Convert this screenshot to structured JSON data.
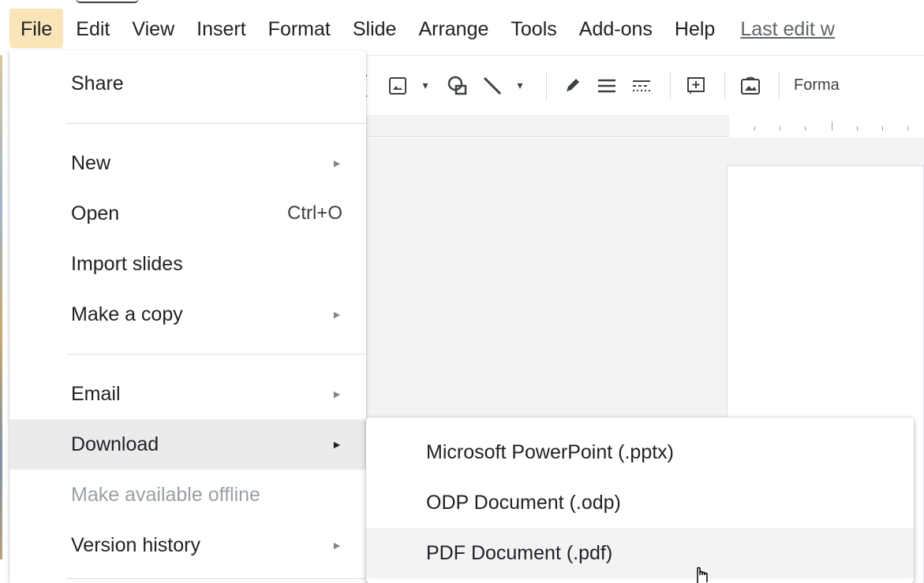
{
  "menubar": {
    "items": [
      {
        "label": "File",
        "active": true
      },
      {
        "label": "Edit"
      },
      {
        "label": "View"
      },
      {
        "label": "Insert"
      },
      {
        "label": "Format"
      },
      {
        "label": "Slide"
      },
      {
        "label": "Arrange"
      },
      {
        "label": "Tools"
      },
      {
        "label": "Add-ons"
      },
      {
        "label": "Help"
      }
    ],
    "last_edit": "Last edit w"
  },
  "toolbar": {
    "format_label": "Forma",
    "icons": [
      "text-cursor-icon",
      "image-icon",
      "shape-icon",
      "line-icon",
      "pen-icon",
      "border-weight-icon",
      "border-dash-icon",
      "comment-add-icon",
      "background-icon"
    ]
  },
  "file_menu": {
    "share": "Share",
    "new": "New",
    "open": "Open",
    "open_shortcut": "Ctrl+O",
    "import_slides": "Import slides",
    "make_copy": "Make a copy",
    "email": "Email",
    "download": "Download",
    "make_offline": "Make available offline",
    "version_history": "Version history",
    "submenu_arrow": "►"
  },
  "download_submenu": {
    "items": [
      {
        "label": "Microsoft PowerPoint (.pptx)"
      },
      {
        "label": "ODP Document (.odp)"
      },
      {
        "label": "PDF Document (.pdf)",
        "hover": true
      }
    ]
  },
  "colors": {
    "active_menu_bg": "#f9e5b8",
    "hover_bg": "#eaebec",
    "disabled_text": "#9aa0a6"
  }
}
